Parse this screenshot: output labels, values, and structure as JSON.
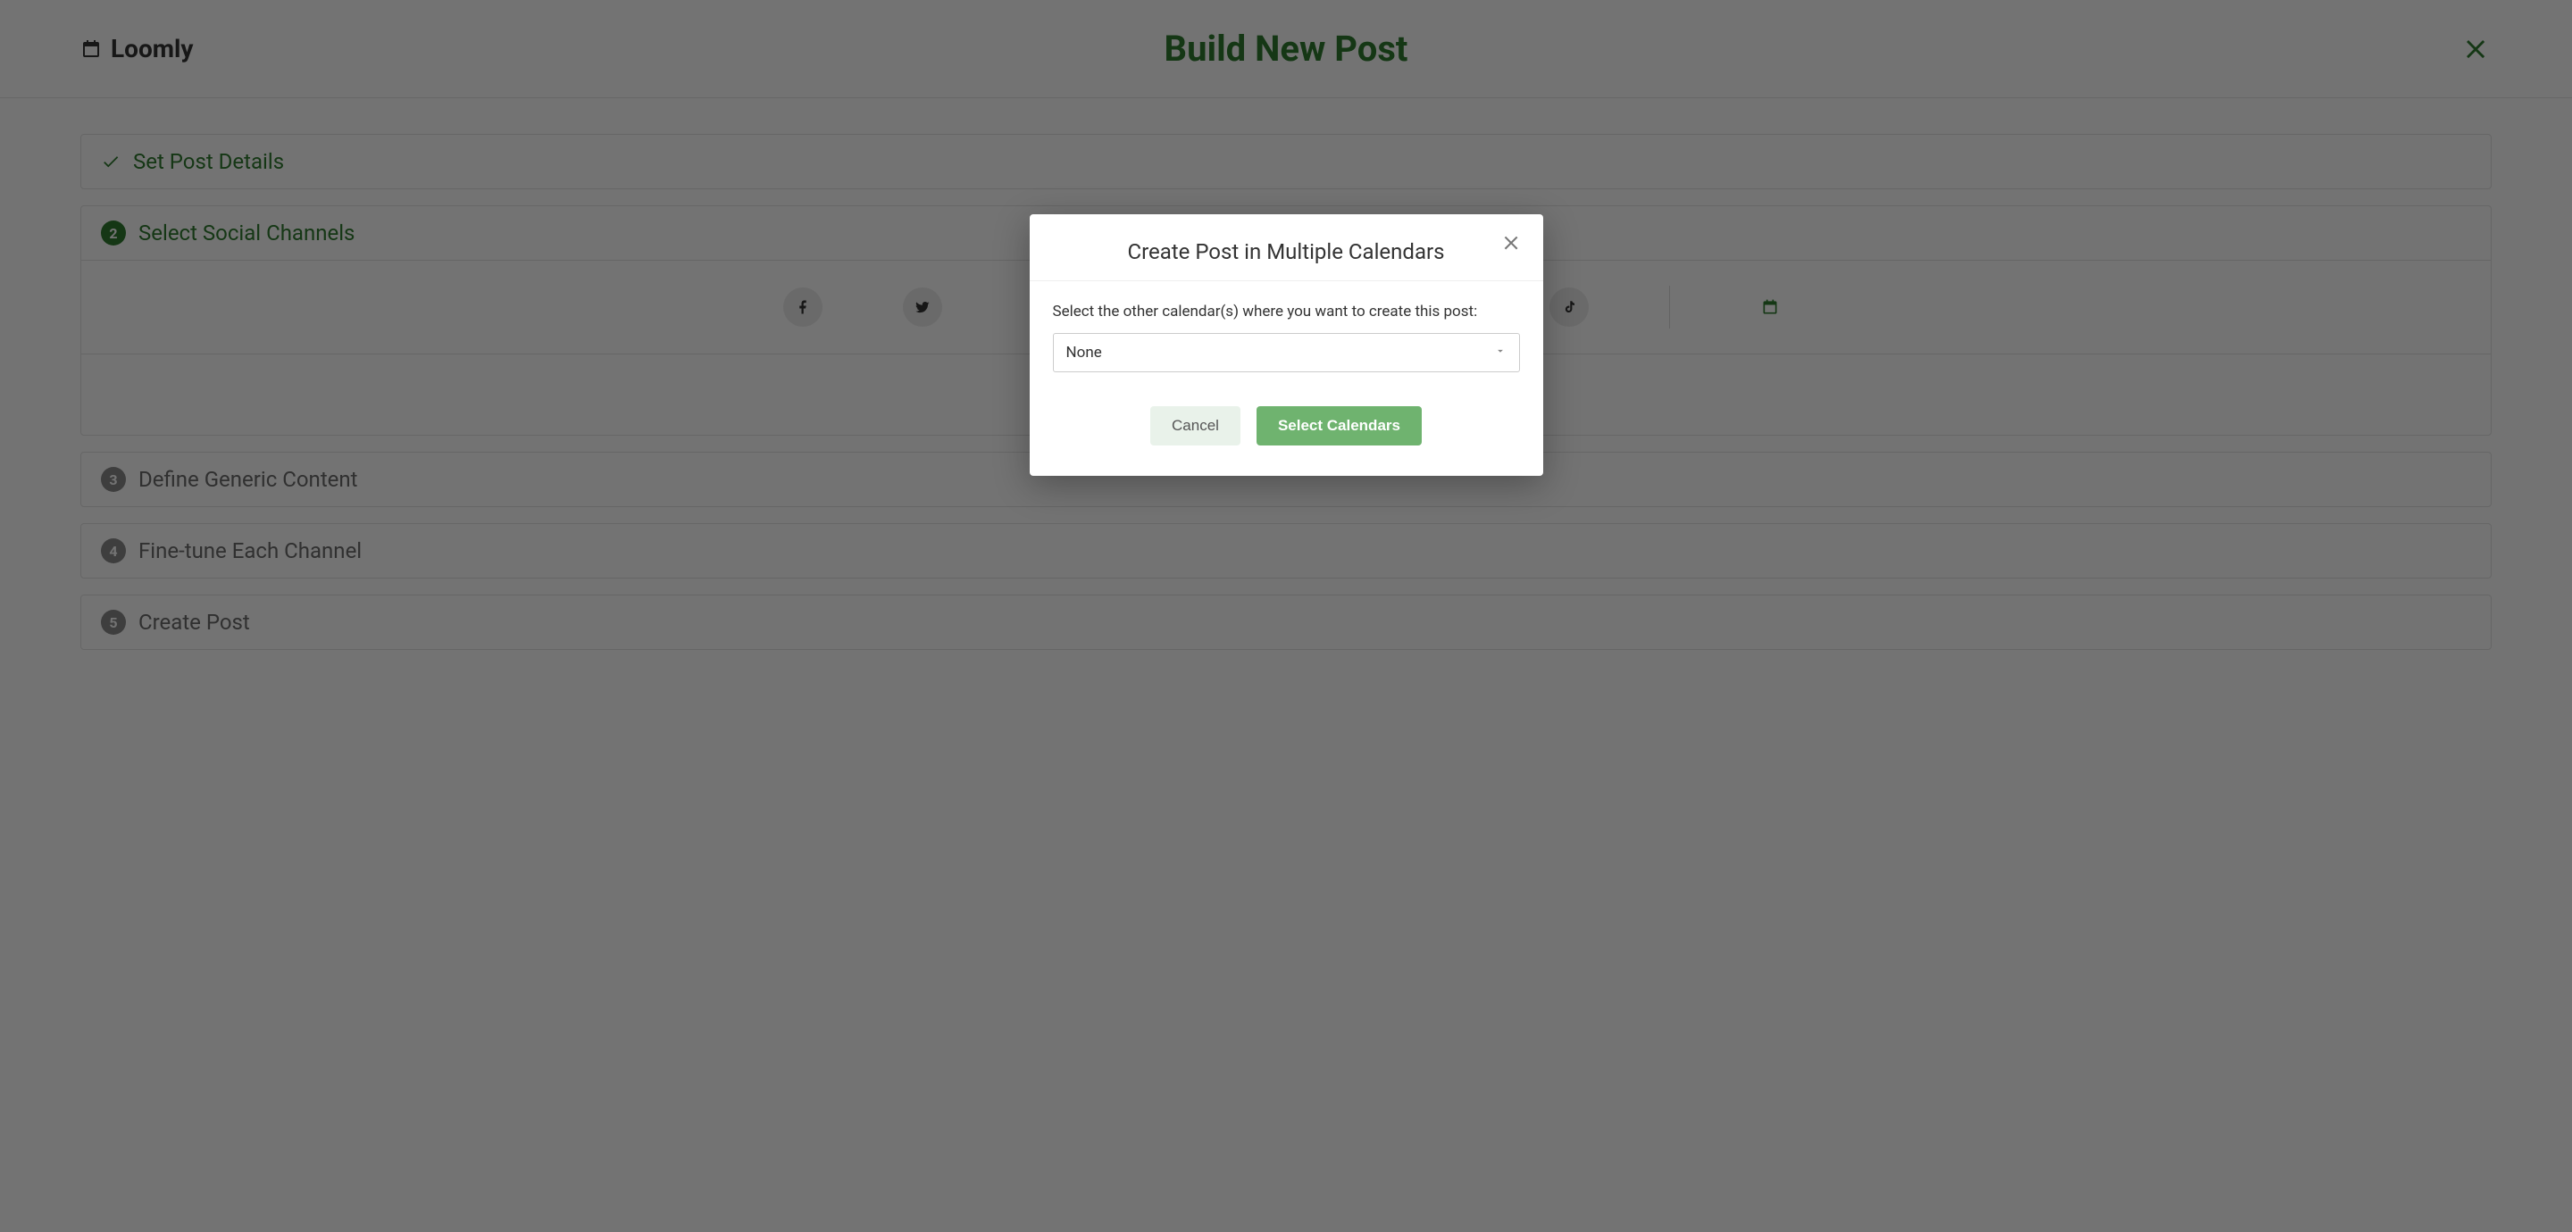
{
  "brand": {
    "name": "Loomly"
  },
  "header": {
    "title": "Build New Post"
  },
  "steps": {
    "one": {
      "label": "Set Post Details"
    },
    "two": {
      "num": "2",
      "label": "Select Social Channels"
    },
    "three": {
      "num": "3",
      "label": "Define Generic Content"
    },
    "four": {
      "num": "4",
      "label": "Fine-tune Each Channel"
    },
    "five": {
      "num": "5",
      "label": "Create Post"
    }
  },
  "channels": {
    "facebook": "facebook",
    "twitter": "twitter",
    "tiktok": "tiktok",
    "calendar": "calendar"
  },
  "modal": {
    "title": "Create Post in Multiple Calendars",
    "instruction": "Select the other calendar(s) where you want to create this post:",
    "select_value": "None",
    "cancel": "Cancel",
    "confirm": "Select Calendars"
  },
  "colors": {
    "accent": "#2f7a2f",
    "primary_btn": "#6fb36f"
  }
}
